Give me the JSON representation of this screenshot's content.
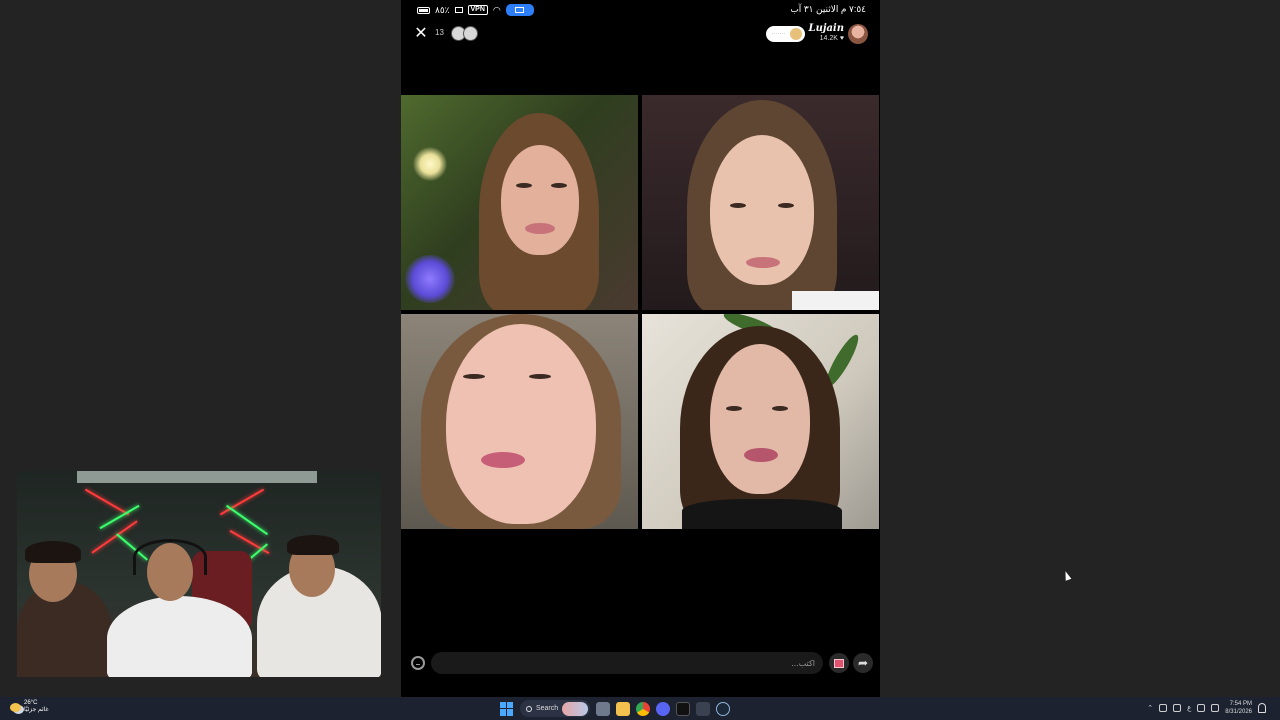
{
  "phone_status": {
    "battery_percent": "٨٥٪",
    "vpn_label": "VPN",
    "time_date": "٧:٥٤ م  الاثنين ٣١ آب"
  },
  "room": {
    "viewer_count": "13",
    "host_name": "Lujain",
    "host_meta": "14.2K"
  },
  "chat": {
    "placeholder": "اكتب..."
  },
  "icons": {
    "close": "close-icon",
    "emoji": "emoji-icon",
    "gift": "gift-icon",
    "share": "share-icon"
  },
  "taskbar": {
    "weather_temp": "26°C",
    "weather_desc": "غائم جزئيًا",
    "search_label": "Search",
    "clock_time": "7:54 PM",
    "clock_date": "8/31/2026",
    "lang": "ع"
  },
  "colors": {
    "accent_blue": "#2d7ff9",
    "gift_pink": "#e0526e",
    "neon_red": "#ff3b3b",
    "neon_green": "#3bff6b"
  }
}
